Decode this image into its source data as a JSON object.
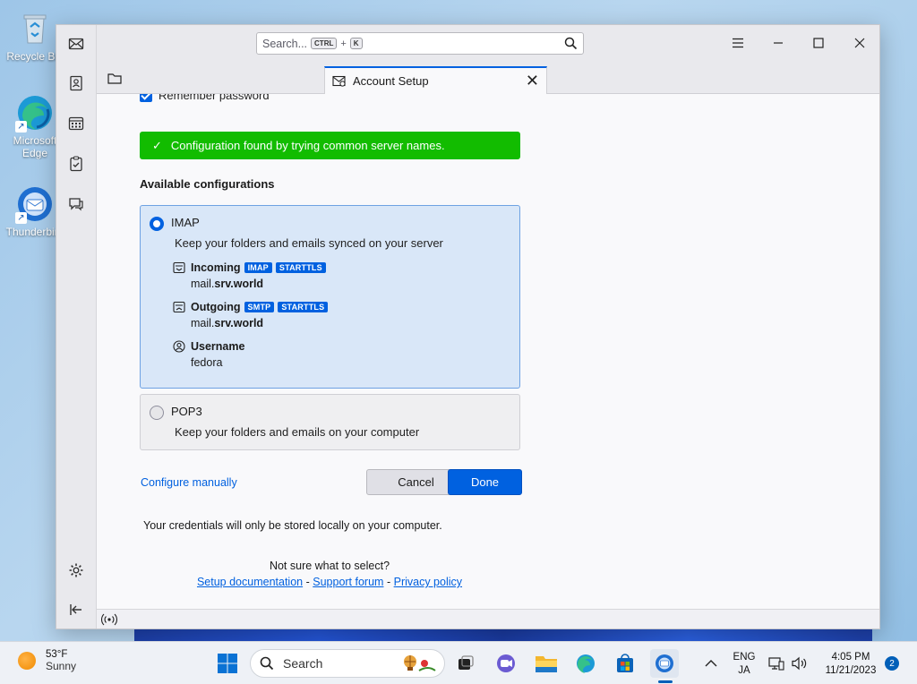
{
  "desktop": {
    "icons": [
      {
        "label": "Recycle Bin"
      },
      {
        "label": "Microsoft Edge"
      },
      {
        "label": "Thunderbird"
      }
    ]
  },
  "window": {
    "search": {
      "placeholder": "Search...",
      "shortcut_key1": "CTRL",
      "shortcut_plus": "+",
      "shortcut_key2": "K"
    },
    "tab": {
      "label": "Account Setup"
    }
  },
  "account_setup": {
    "remember_password": "Remember password",
    "success_message": "Configuration found by trying common server names.",
    "available_title": "Available configurations",
    "imap": {
      "name": "IMAP",
      "description": "Keep your folders and emails synced on your server",
      "incoming": {
        "label": "Incoming",
        "badges": [
          "IMAP",
          "STARTTLS"
        ],
        "host_prefix": "mail.",
        "host_domain": "srv.world"
      },
      "outgoing": {
        "label": "Outgoing",
        "badges": [
          "SMTP",
          "STARTTLS"
        ],
        "host_prefix": "mail.",
        "host_domain": "srv.world"
      },
      "username": {
        "label": "Username",
        "value": "fedora"
      }
    },
    "pop3": {
      "name": "POP3",
      "description": "Keep your folders and emails on your computer"
    },
    "configure_manually": "Configure manually",
    "cancel": "Cancel",
    "done": "Done",
    "credentials_note": "Your credentials will only be stored locally on your computer.",
    "not_sure": "Not sure what to select?",
    "links": {
      "setup_docs": "Setup documentation",
      "sep1": "-",
      "support_forum": "Support forum",
      "sep2": "-",
      "privacy": "Privacy policy"
    }
  },
  "taskbar": {
    "weather_temp": "53°F",
    "weather_desc": "Sunny",
    "search_label": "Search",
    "lang1": "ENG",
    "lang2": "JA",
    "time": "4:05 PM",
    "date": "11/21/2023",
    "notifications": "2"
  },
  "colors": {
    "accent": "#0061e0",
    "success": "#12bc00",
    "selected_bg": "#d9e7f8"
  }
}
